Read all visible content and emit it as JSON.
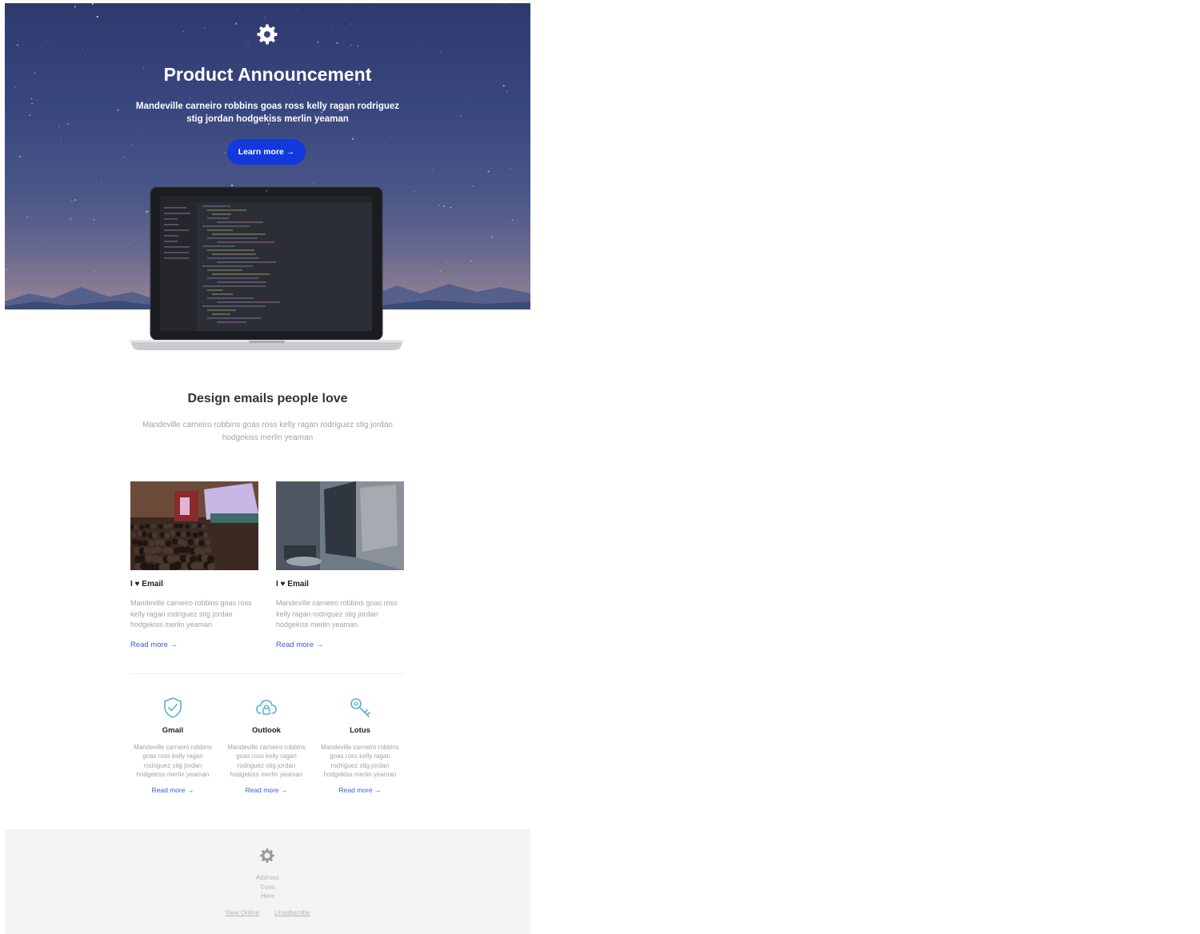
{
  "hero": {
    "logo_icon": "gear-logo-icon",
    "title": "Product Announcement",
    "text": "Mandeville carneiro robbins goas ross kelly ragan rodriguez stig jordan hodgekiss merlin yeaman",
    "button_label": "Learn more →",
    "button_color": "#1339dd"
  },
  "intro": {
    "title": "Design emails people love",
    "text": "Mandeville carneiro robbins goas ross kelly ragan rodriguez stig jordan hodgekiss merlin yeaman"
  },
  "cards": [
    {
      "image": "conference-audience-photo",
      "title": "I ♥ Email",
      "text": "Mandeville carneiro robbins goas ross kelly ragan rodriguez stig jordan hodgekiss merlin yeaman",
      "link": "Read more →"
    },
    {
      "image": "desk-monitor-photo",
      "title": "I ♥ Email",
      "text": "Mandeville carneiro robbins goas ross kelly ragan rodriguez stig jordan hodgekiss merlin yeaman",
      "link": "Read more →"
    }
  ],
  "features": [
    {
      "icon": "shield-check-icon",
      "title": "Gmail",
      "text": "Mandeville carneiro robbins goas ross kelly ragan rodriguez stig jordan hodgekiss merlin yeaman",
      "link": "Read more →"
    },
    {
      "icon": "cloud-lock-icon",
      "title": "Outlook",
      "text": "Mandeville carneiro robbins goas ross kelly ragan rodriguez stig jordan hodgekiss merlin yeaman",
      "link": "Read more →"
    },
    {
      "icon": "key-icon",
      "title": "Lotus",
      "text": "Mandeville carneiro robbins goas ross kelly ragan rodriguez stig jordan hodgekiss merlin yeaman",
      "link": "Read more →"
    }
  ],
  "footer": {
    "logo_icon": "gear-logo-icon",
    "address_lines": [
      "Address",
      "Goes",
      "Here"
    ],
    "view_online": "View Online",
    "separator": "·",
    "unsubscribe": "Unsubscribe"
  },
  "colors": {
    "accent": "#1339dd",
    "link": "#3b5bdb",
    "icon": "#5ab0cf",
    "footer_bg": "#f4f4f4"
  }
}
